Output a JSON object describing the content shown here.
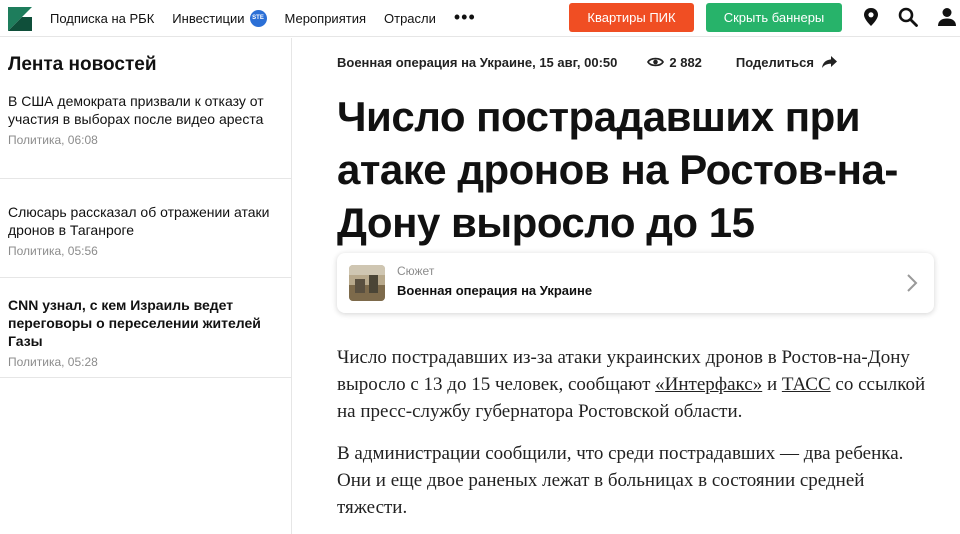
{
  "nav": {
    "items": [
      {
        "label": "Подписка на РБК"
      },
      {
        "label": "Инвестиции",
        "badge": "STE"
      },
      {
        "label": "Мероприятия"
      },
      {
        "label": "Отрасли"
      }
    ],
    "more": "•••",
    "btn_pik": "Квартиры ПИК",
    "btn_hide": "Скрыть баннеры",
    "colors": {
      "pik": "#f04e23",
      "hide": "#27b36a",
      "logo": "#1e7d5c"
    }
  },
  "feed": {
    "title": "Лента новостей",
    "items": [
      {
        "title": "В США демократа призвали к отказу от участия в выборах после видео ареста",
        "meta": "Политика, 06:08"
      },
      {
        "title": "Слюсарь рассказал об отражении атаки дронов в Таганроге",
        "meta": "Политика, 05:56"
      },
      {
        "title": "CNN узнал, с кем Израиль ведет переговоры о переселении жителей Газы",
        "meta": "Политика, 05:28"
      }
    ]
  },
  "article": {
    "meta": {
      "rubric_date": "Военная операция на Украине, 15 авг, 00:50",
      "views": "2 882",
      "share": "Поделиться"
    },
    "headline": "Число пострадавших при атаке дронов на Ростов-на-Дону выросло до 15",
    "story": {
      "label": "Сюжет",
      "name": "Военная операция на Украине"
    },
    "p1": {
      "before": "Число пострадавших из-за атаки украинских дронов в Ростов-на-Дону выросло с 13 до 15 человек, сообщают ",
      "link1": "«Интерфакс»",
      "mid": " и ",
      "link2": "ТАСС",
      "after": " со ссылкой на пресс-службу губернатора Ростовской области."
    },
    "p2": "В администрации сообщили, что среди пострадавших — два ребенка. Они и еще двое раненых лежат в больницах в состоянии средней тяжести."
  }
}
